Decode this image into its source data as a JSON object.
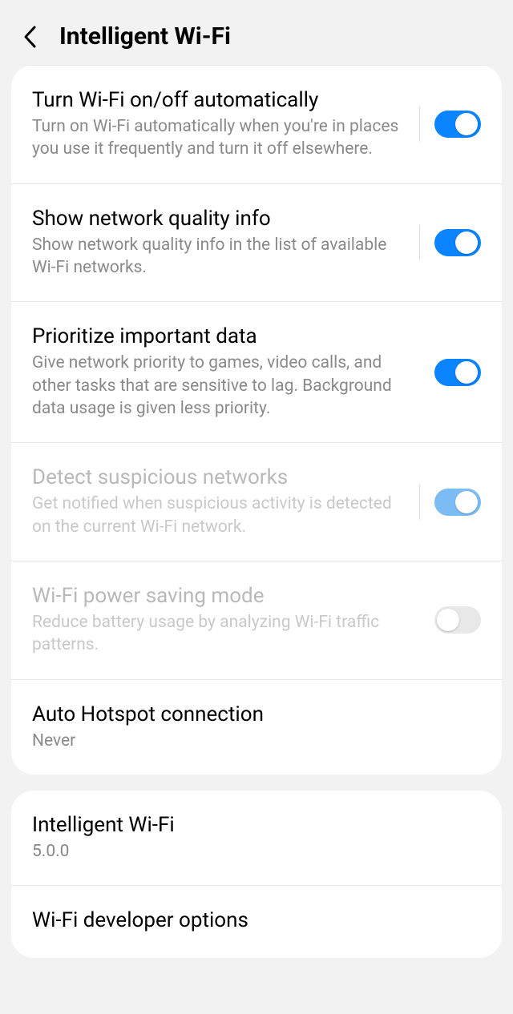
{
  "header": {
    "title": "Intelligent Wi-Fi"
  },
  "settings": [
    {
      "title": "Turn Wi-Fi on/off automatically",
      "sub": "Turn on Wi-Fi automatically when you're in places you use it frequently and turn it off elsewhere.",
      "toggle": "on",
      "disabled": false
    },
    {
      "title": "Show network quality info",
      "sub": "Show network quality info in the list of available Wi-Fi networks.",
      "toggle": "on",
      "disabled": false
    },
    {
      "title": "Prioritize important data",
      "sub": "Give network priority to games, video calls, and other tasks that are sensitive to lag. Background data usage is given less priority.",
      "toggle": "on",
      "disabled": false
    },
    {
      "title": "Detect suspicious networks",
      "sub": "Get notified when suspicious activity is detected on the current Wi-Fi network.",
      "toggle": "on",
      "disabled": true
    },
    {
      "title": "Wi-Fi power saving mode",
      "sub": "Reduce battery usage by analyzing Wi-Fi traffic patterns.",
      "toggle": "off",
      "disabled": true
    }
  ],
  "hotspot": {
    "title": "Auto Hotspot connection",
    "value": "Never"
  },
  "version": {
    "title": "Intelligent Wi-Fi",
    "value": "5.0.0"
  },
  "dev": {
    "title": "Wi-Fi developer options"
  }
}
